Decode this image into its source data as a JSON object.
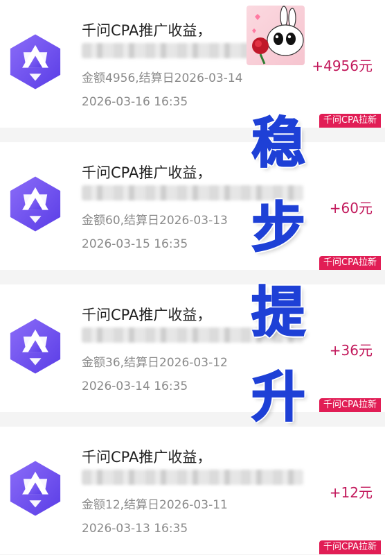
{
  "records": [
    {
      "title": "千问CPA推广收益，",
      "amount_line": "金额4956,结算日2026-03-14",
      "time": "2026-03-16 16:35",
      "income": "+4956元",
      "tag": "千问CPA拉新"
    },
    {
      "title": "千问CPA推广收益，",
      "amount_line": "金额60,结算日2026-03-13",
      "time": "2026-03-15 16:35",
      "income": "+60元",
      "tag": "千问CPA拉新"
    },
    {
      "title": "千问CPA推广收益，",
      "amount_line": "金额36,结算日2026-03-12",
      "time": "2026-03-14 16:35",
      "income": "+36元",
      "tag": "千问CPA拉新"
    },
    {
      "title": "千问CPA推广收益，",
      "amount_line": "金额12,结算日2026-03-11",
      "time": "2026-03-13 16:35",
      "income": "+12元",
      "tag": "千问CPA拉新"
    }
  ],
  "overlay": {
    "chars": [
      "稳",
      "步",
      "提",
      "升"
    ]
  },
  "colors": {
    "income": "#c2185b",
    "tag_bg": "#e11d55",
    "overlay_text": "#1e40d6",
    "logo_purple": "#6c4cf2"
  }
}
